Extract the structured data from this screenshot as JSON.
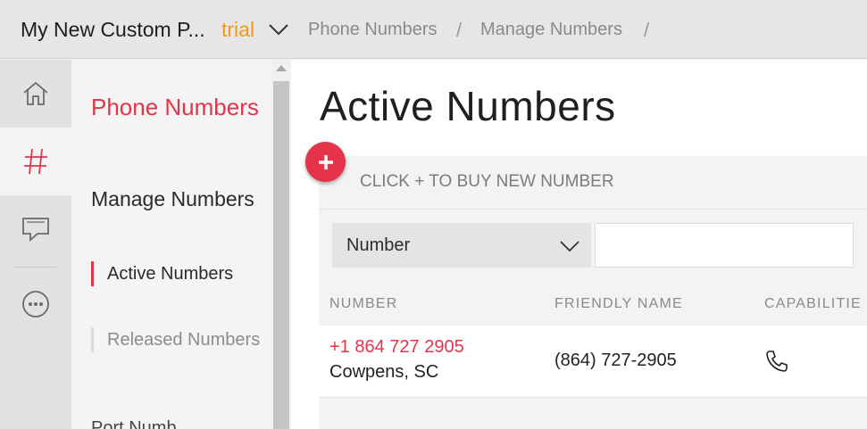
{
  "header": {
    "project_name": "My New Custom P...",
    "trial_label": "trial",
    "breadcrumbs": [
      "Phone Numbers",
      "Manage Numbers"
    ],
    "separator": "/"
  },
  "rail": {
    "items": [
      {
        "icon": "home-icon"
      },
      {
        "icon": "hash-icon",
        "active": true
      },
      {
        "icon": "chat-icon"
      },
      {
        "icon": "more-icon"
      }
    ]
  },
  "subnav": {
    "title": "Phone Numbers",
    "section": "Manage Numbers",
    "links": [
      {
        "label": "Active Numbers",
        "active": true
      },
      {
        "label": "Released Numbers",
        "active": false
      }
    ],
    "cut_off": "Port Numb..."
  },
  "main": {
    "title": "Active Numbers",
    "buy_prompt": "CLICK + TO BUY NEW NUMBER",
    "filter": {
      "selected": "Number",
      "input_value": ""
    },
    "columns": [
      "NUMBER",
      "FRIENDLY NAME",
      "CAPABILITIE"
    ],
    "rows": [
      {
        "number": "+1 864 727 2905",
        "location": "Cowpens, SC",
        "friendly_name": "(864) 727-2905",
        "capabilities": [
          "phone-icon"
        ]
      }
    ]
  },
  "colors": {
    "accent": "#e5344a",
    "trial": "#f29a19"
  }
}
